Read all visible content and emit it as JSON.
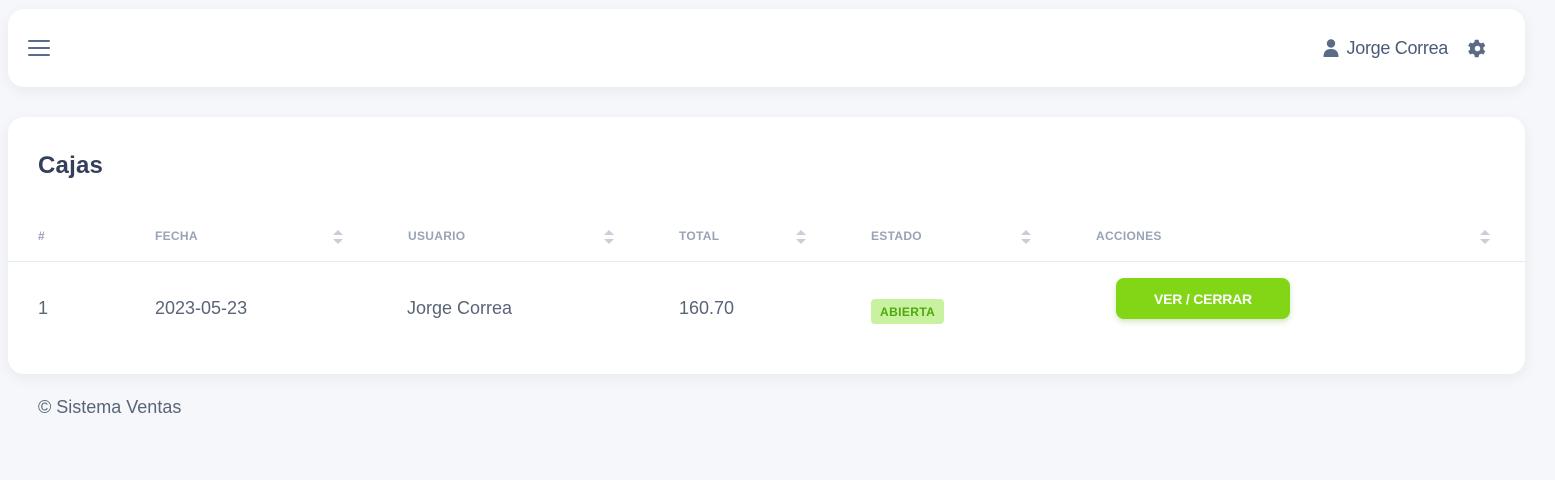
{
  "topbar": {
    "user_name": "Jorge Correa"
  },
  "main": {
    "title": "Cajas",
    "columns": [
      "#",
      "FECHA",
      "USUARIO",
      "TOTAL",
      "ESTADO",
      "ACCIONES"
    ],
    "rows": [
      {
        "id": "1",
        "fecha": "2023-05-23",
        "usuario": "Jorge Correa",
        "total": "160.70",
        "estado": "ABIERTA",
        "accion": "VER / CERRAR"
      }
    ]
  },
  "footer": {
    "text": "© Sistema Ventas"
  },
  "colors": {
    "accent": "#82d616",
    "badge_bg": "#c8f1a0",
    "badge_text": "#4fa80e"
  },
  "icons": [
    "menu-icon",
    "user-icon",
    "gear-icon",
    "sort-icon"
  ]
}
